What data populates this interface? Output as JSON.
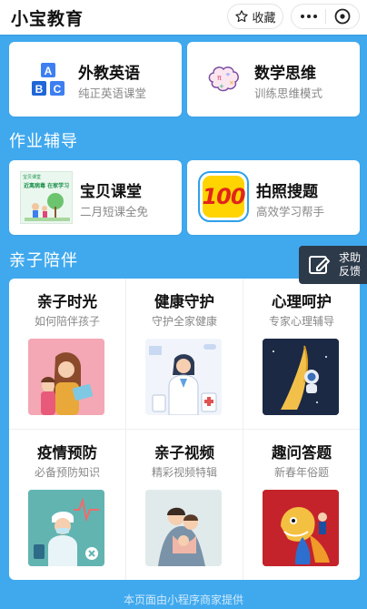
{
  "header": {
    "app_title": "小宝教育",
    "favorite_label": "收藏"
  },
  "top_cards": [
    {
      "title": "外教英语",
      "subtitle": "纯正英语课堂",
      "icon": "abc-blocks-icon"
    },
    {
      "title": "数学思维",
      "subtitle": "训练思维模式",
      "icon": "brain-icon"
    }
  ],
  "homework": {
    "section_title": "作业辅导",
    "cards": [
      {
        "title": "宝贝课堂",
        "subtitle": "二月短课全免",
        "thumb_caption_1": "宝贝课堂",
        "thumb_caption_2": "近离病毒 在家学习"
      },
      {
        "title": "拍照搜题",
        "subtitle": "高效学习帮手",
        "badge_text": "100"
      }
    ]
  },
  "parenting": {
    "section_title": "亲子陪伴",
    "items": [
      {
        "title": "亲子时光",
        "subtitle": "如何陪伴孩子",
        "image": "mother-reading-image"
      },
      {
        "title": "健康守护",
        "subtitle": "守护全家健康",
        "image": "doctor-image"
      },
      {
        "title": "心理呵护",
        "subtitle": "专家心理辅导",
        "image": "astronaut-image"
      },
      {
        "title": "疫情预防",
        "subtitle": "必备预防知识",
        "image": "nurse-image"
      },
      {
        "title": "亲子视频",
        "subtitle": "精彩视频特辑",
        "image": "family-hug-image"
      },
      {
        "title": "趣问答题",
        "subtitle": "新春年俗题",
        "image": "lion-dance-image"
      }
    ]
  },
  "help_button": {
    "line1": "求助",
    "line2": "反馈"
  },
  "footer": {
    "text": "本页面由小程序商家提供"
  },
  "colors": {
    "background": "#40a9ee",
    "card": "#ffffff",
    "help": "#2d3a4a"
  }
}
